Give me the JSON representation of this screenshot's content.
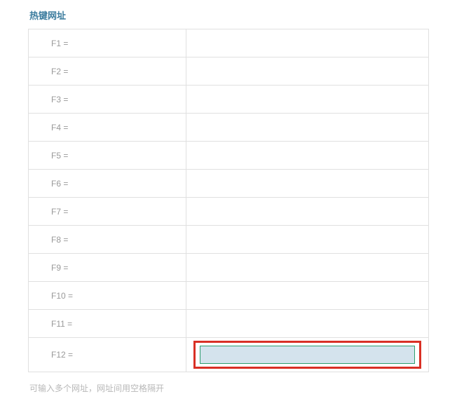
{
  "section": {
    "title": "热键网址"
  },
  "hotkeys": {
    "rows": [
      {
        "label": "F1 =",
        "value": ""
      },
      {
        "label": "F2 =",
        "value": ""
      },
      {
        "label": "F3 =",
        "value": ""
      },
      {
        "label": "F4 =",
        "value": ""
      },
      {
        "label": "F5 =",
        "value": ""
      },
      {
        "label": "F6 =",
        "value": ""
      },
      {
        "label": "F7 =",
        "value": ""
      },
      {
        "label": "F8 =",
        "value": ""
      },
      {
        "label": "F9 =",
        "value": ""
      },
      {
        "label": "F10 =",
        "value": ""
      },
      {
        "label": "F11 =",
        "value": ""
      },
      {
        "label": "F12 =",
        "value": ""
      }
    ]
  },
  "footer": {
    "hint": "可输入多个网址，网址间用空格隔开"
  }
}
